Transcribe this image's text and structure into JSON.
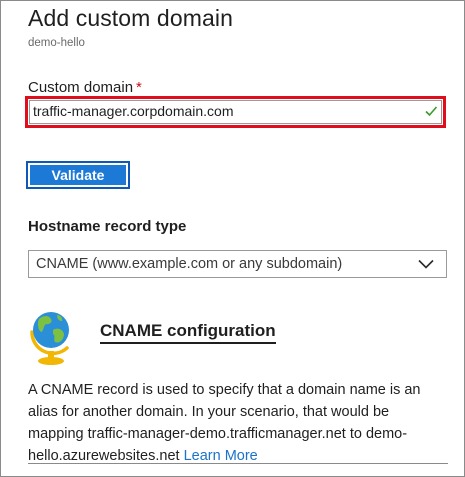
{
  "panel": {
    "title": "Add custom domain",
    "subtitle": "demo-hello"
  },
  "custom_domain": {
    "label": "Custom domain",
    "required_marker": "*",
    "value": "traffic-manager.corpdomain.com",
    "status_icon": "checkmark-icon",
    "highlight_color": "#e00d1c"
  },
  "validate_button": {
    "label": "Validate",
    "color": "#1d79d6"
  },
  "hostname_record": {
    "label": "Hostname record type",
    "selected": "CNAME (www.example.com or any subdomain)"
  },
  "cname_section": {
    "icon": "globe-icon",
    "heading": "CNAME configuration",
    "description": "A CNAME record is used to specify that a domain name is an alias for another domain. In your scenario, that would be mapping traffic-manager-demo.trafficmanager.net to demo-hello.azurewebsites.net",
    "learn_more": "Learn More",
    "link_color": "#1a73c8"
  }
}
